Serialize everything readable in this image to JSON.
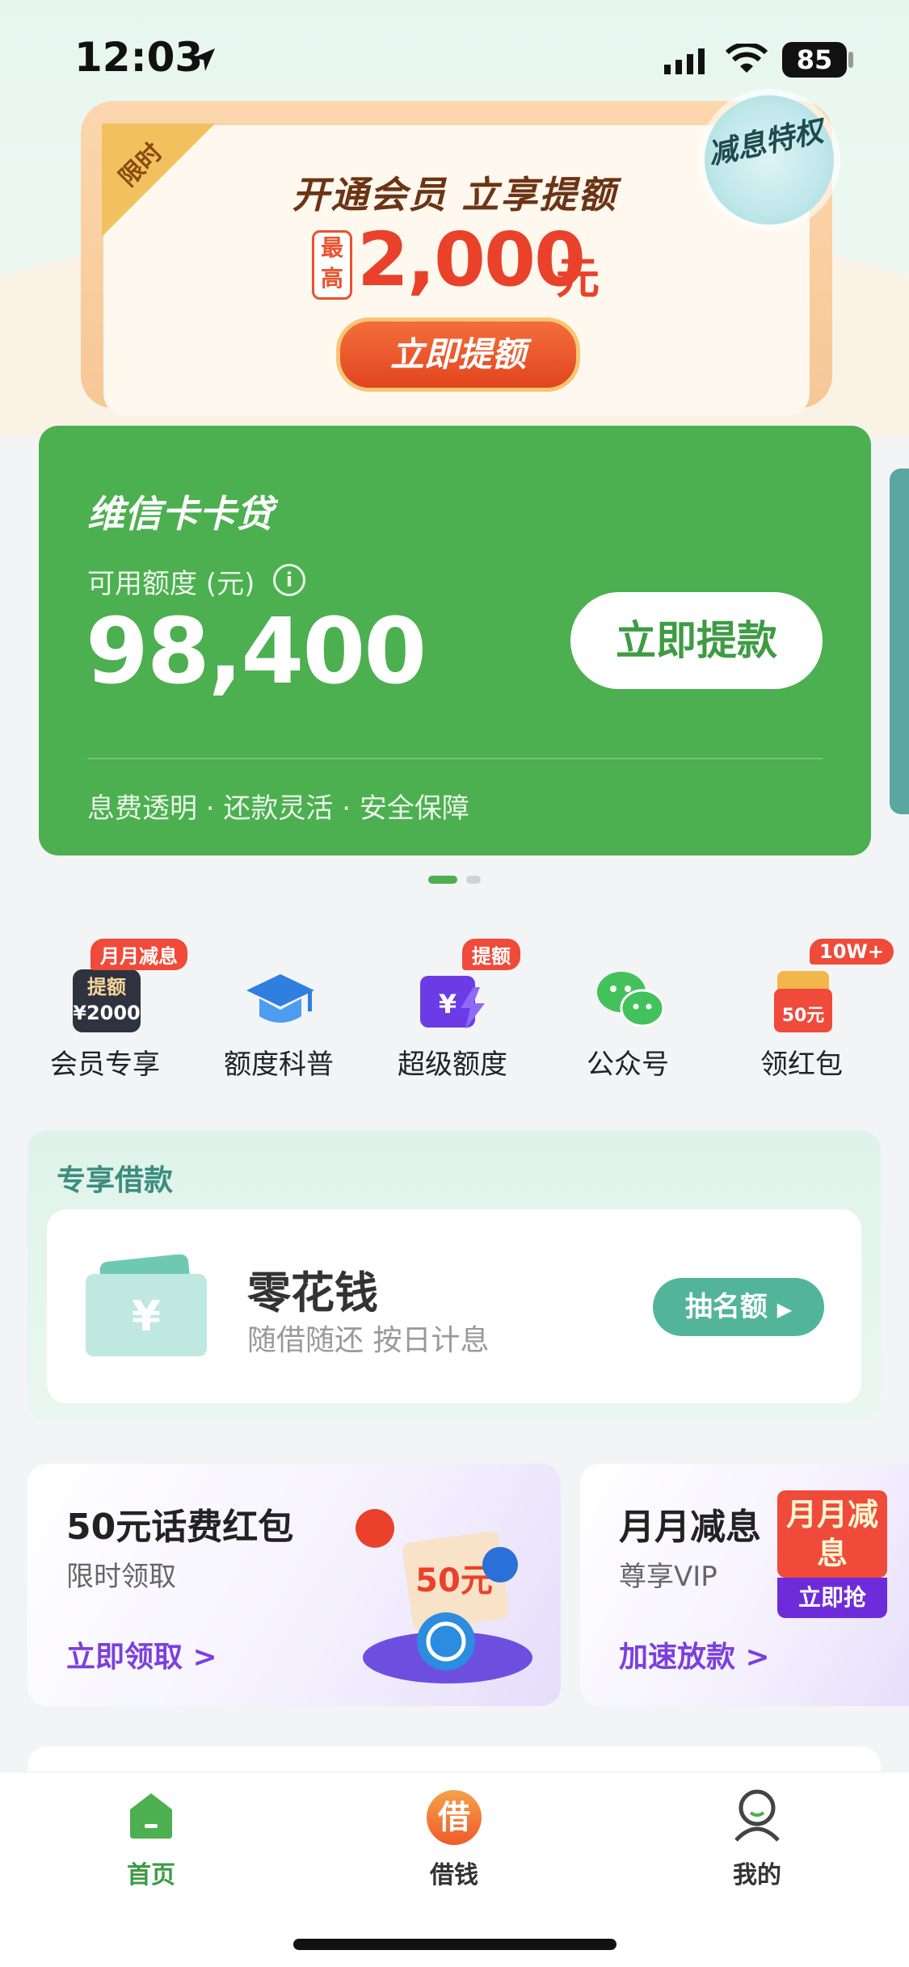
{
  "status_bar": {
    "time": "12:03",
    "battery": "85"
  },
  "banner": {
    "ribbon": "限时",
    "title": "开通会员  立享提额",
    "max_tag": "最高",
    "amount": "2,000",
    "unit": "元",
    "button": "立即提额",
    "badge": "减息特权"
  },
  "loan_card": {
    "brand": "维信卡卡贷",
    "label": "可用额度 (元)",
    "amount": "98,400",
    "button": "立即提款",
    "footer": "息费透明 · 还款灵活 · 安全保障"
  },
  "shortcuts": [
    {
      "label": "会员专享",
      "tag": "月月减息",
      "icon": "member-icon",
      "icon_text": "提额 ¥2000"
    },
    {
      "label": "额度科普",
      "tag": "",
      "icon": "graduation-cap-icon"
    },
    {
      "label": "超级额度",
      "tag": "提额",
      "icon": "super-limit-icon"
    },
    {
      "label": "公众号",
      "tag": "",
      "icon": "wechat-icon"
    },
    {
      "label": "领红包",
      "tag": "10W+",
      "icon": "red-packet-icon",
      "icon_text": "50元"
    }
  ],
  "exclusive": {
    "title": "专享借款",
    "name": "零花钱",
    "subtitle": "随借随还  按日计息",
    "button": "抽名额"
  },
  "promos": [
    {
      "title": "50元话费红包",
      "subtitle": "限时领取",
      "link": "立即领取 >",
      "badge": "50元"
    },
    {
      "title": "月月减息",
      "subtitle": "尊享VIP",
      "link": "加速放款 >",
      "badge_top": "月月减息",
      "badge_bottom": "立即抢"
    }
  ],
  "tabbar": [
    {
      "label": "首页",
      "active": true
    },
    {
      "label": "借钱",
      "icon_text": "借"
    },
    {
      "label": "我的"
    }
  ],
  "colors": {
    "brand_green": "#4caf50",
    "tab_active": "#3e9b44",
    "accent_red": "#e9412a",
    "purple_link": "#7b3fe0"
  }
}
